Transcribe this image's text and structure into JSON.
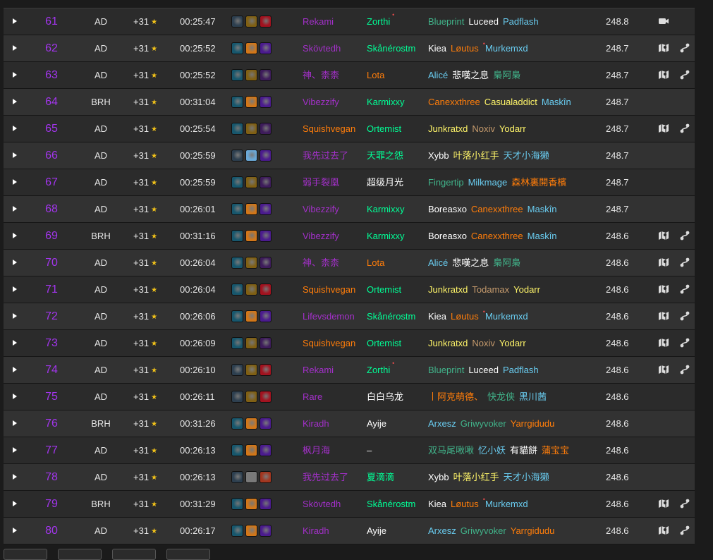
{
  "rows": [
    {
      "rank": "61",
      "dungeon": "AD",
      "level": "+31",
      "time": "00:25:47",
      "affixes": [
        "#2d3f4f",
        "#806014",
        "#a3121f"
      ],
      "tank": {
        "name": "Rekami",
        "color": "#a330c9"
      },
      "healer": {
        "name": "Zorthi",
        "color": "#00ff96",
        "mark": "•"
      },
      "dps": [
        {
          "name": "Blueprint",
          "color": "#41b38a"
        },
        {
          "name": "Luceed",
          "color": "#ffffff"
        },
        {
          "name": "Padflash",
          "color": "#69ccf0"
        }
      ],
      "score": "248.8",
      "icon1": "video-icon",
      "icon2": ""
    },
    {
      "rank": "62",
      "dungeon": "AD",
      "level": "+31",
      "time": "00:25:52",
      "affixes": [
        "#17576d",
        "#d27719",
        "#4b1b8e"
      ],
      "tank": {
        "name": "Skövtedh",
        "color": "#a330c9"
      },
      "healer": {
        "name": "Skånérostm",
        "color": "#00ff96"
      },
      "dps": [
        {
          "name": "Kiea",
          "color": "#ffffff"
        },
        {
          "name": "Løutus",
          "color": "#ff7d0a",
          "mark": "•"
        },
        {
          "name": "Murkemxd",
          "color": "#69ccf0"
        }
      ],
      "score": "248.7",
      "icon1": "map-icon",
      "icon2": "route-icon"
    },
    {
      "rank": "63",
      "dungeon": "AD",
      "level": "+31",
      "time": "00:25:52",
      "affixes": [
        "#17576d",
        "#806014",
        "#3e1c5b"
      ],
      "tank": {
        "name": "神、柰柰",
        "color": "#a330c9"
      },
      "healer": {
        "name": "Lota",
        "color": "#ff7d0a"
      },
      "dps": [
        {
          "name": "Alicé",
          "color": "#69ccf0"
        },
        {
          "name": "悲嘆之息",
          "color": "#ffffff"
        },
        {
          "name": "梟阿梟",
          "color": "#41b38a"
        }
      ],
      "score": "248.7",
      "icon1": "map-icon",
      "icon2": "route-icon"
    },
    {
      "rank": "64",
      "dungeon": "BRH",
      "level": "+31",
      "time": "00:31:04",
      "affixes": [
        "#17576d",
        "#d27719",
        "#4b1b8e"
      ],
      "tank": {
        "name": "Vibezzify",
        "color": "#a330c9"
      },
      "healer": {
        "name": "Karmixxy",
        "color": "#00ff96"
      },
      "dps": [
        {
          "name": "Canexxthree",
          "color": "#ff7d0a"
        },
        {
          "name": "Casualaddict",
          "color": "#fff569"
        },
        {
          "name": "Maskîn",
          "color": "#69ccf0"
        }
      ],
      "score": "248.7",
      "icon1": "",
      "icon2": ""
    },
    {
      "rank": "65",
      "dungeon": "AD",
      "level": "+31",
      "time": "00:25:54",
      "affixes": [
        "#17576d",
        "#806014",
        "#3e1c5b"
      ],
      "tank": {
        "name": "Squishvegan",
        "color": "#ff7d0a"
      },
      "healer": {
        "name": "Ortemist",
        "color": "#00ff96"
      },
      "dps": [
        {
          "name": "Junkratxd",
          "color": "#fff569"
        },
        {
          "name": "Noxiv",
          "color": "#c69b6d"
        },
        {
          "name": "Yodarr",
          "color": "#fff569"
        }
      ],
      "score": "248.7",
      "icon1": "map-icon",
      "icon2": "route-icon"
    },
    {
      "rank": "66",
      "dungeon": "AD",
      "level": "+31",
      "time": "00:25:59",
      "affixes": [
        "#2d3f4f",
        "#6aa9d8",
        "#4b1b8e"
      ],
      "tank": {
        "name": "我先过去了",
        "color": "#a330c9"
      },
      "healer": {
        "name": "天罪之怨",
        "color": "#00ff96"
      },
      "dps": [
        {
          "name": "Xybb",
          "color": "#ffffff"
        },
        {
          "name": "叶落小红手",
          "color": "#fff569"
        },
        {
          "name": "天才小海獭",
          "color": "#69ccf0"
        }
      ],
      "score": "248.7",
      "icon1": "",
      "icon2": ""
    },
    {
      "rank": "67",
      "dungeon": "AD",
      "level": "+31",
      "time": "00:25:59",
      "affixes": [
        "#17576d",
        "#806014",
        "#3e1c5b"
      ],
      "tank": {
        "name": "弱手裂凰",
        "color": "#a330c9"
      },
      "healer": {
        "name": "超级月光",
        "color": "#ffffff"
      },
      "dps": [
        {
          "name": "Fingertip",
          "color": "#41b38a"
        },
        {
          "name": "Milkmage",
          "color": "#69ccf0"
        },
        {
          "name": "森林裏開香檳",
          "color": "#ff7d0a"
        }
      ],
      "score": "248.7",
      "icon1": "",
      "icon2": ""
    },
    {
      "rank": "68",
      "dungeon": "AD",
      "level": "+31",
      "time": "00:26:01",
      "affixes": [
        "#17576d",
        "#d27719",
        "#4b1b8e"
      ],
      "tank": {
        "name": "Vibezzify",
        "color": "#a330c9"
      },
      "healer": {
        "name": "Karmixxy",
        "color": "#00ff96"
      },
      "dps": [
        {
          "name": "Boreasxo",
          "color": "#ffffff"
        },
        {
          "name": "Canexxthree",
          "color": "#ff7d0a"
        },
        {
          "name": "Maskîn",
          "color": "#69ccf0"
        }
      ],
      "score": "248.7",
      "icon1": "",
      "icon2": ""
    },
    {
      "rank": "69",
      "dungeon": "BRH",
      "level": "+31",
      "time": "00:31:16",
      "affixes": [
        "#17576d",
        "#d27719",
        "#4b1b8e"
      ],
      "tank": {
        "name": "Vibezzify",
        "color": "#a330c9"
      },
      "healer": {
        "name": "Karmixxy",
        "color": "#00ff96"
      },
      "dps": [
        {
          "name": "Boreasxo",
          "color": "#ffffff"
        },
        {
          "name": "Canexxthree",
          "color": "#ff7d0a"
        },
        {
          "name": "Maskîn",
          "color": "#69ccf0"
        }
      ],
      "score": "248.6",
      "icon1": "map-icon",
      "icon2": "route-icon"
    },
    {
      "rank": "70",
      "dungeon": "AD",
      "level": "+31",
      "time": "00:26:04",
      "affixes": [
        "#17576d",
        "#806014",
        "#3e1c5b"
      ],
      "tank": {
        "name": "神、柰柰",
        "color": "#a330c9"
      },
      "healer": {
        "name": "Lota",
        "color": "#ff7d0a"
      },
      "dps": [
        {
          "name": "Alicé",
          "color": "#69ccf0"
        },
        {
          "name": "悲嘆之息",
          "color": "#ffffff"
        },
        {
          "name": "梟阿梟",
          "color": "#41b38a"
        }
      ],
      "score": "248.6",
      "icon1": "map-icon",
      "icon2": "route-icon"
    },
    {
      "rank": "71",
      "dungeon": "AD",
      "level": "+31",
      "time": "00:26:04",
      "affixes": [
        "#17576d",
        "#806014",
        "#a3121f"
      ],
      "tank": {
        "name": "Squishvegan",
        "color": "#ff7d0a"
      },
      "healer": {
        "name": "Ortemist",
        "color": "#00ff96"
      },
      "dps": [
        {
          "name": "Junkratxd",
          "color": "#fff569"
        },
        {
          "name": "Todamax",
          "color": "#c69b6d"
        },
        {
          "name": "Yodarr",
          "color": "#fff569"
        }
      ],
      "score": "248.6",
      "icon1": "map-icon",
      "icon2": "route-icon"
    },
    {
      "rank": "72",
      "dungeon": "AD",
      "level": "+31",
      "time": "00:26:06",
      "affixes": [
        "#17576d",
        "#d27719",
        "#4b1b8e"
      ],
      "tank": {
        "name": "Lifevsdemon",
        "color": "#a330c9"
      },
      "healer": {
        "name": "Skånérostm",
        "color": "#00ff96"
      },
      "dps": [
        {
          "name": "Kiea",
          "color": "#ffffff"
        },
        {
          "name": "Løutus",
          "color": "#ff7d0a",
          "mark": "•"
        },
        {
          "name": "Murkemxd",
          "color": "#69ccf0"
        }
      ],
      "score": "248.6",
      "icon1": "map-icon",
      "icon2": "route-icon"
    },
    {
      "rank": "73",
      "dungeon": "AD",
      "level": "+31",
      "time": "00:26:09",
      "affixes": [
        "#17576d",
        "#806014",
        "#3e1c5b"
      ],
      "tank": {
        "name": "Squishvegan",
        "color": "#ff7d0a"
      },
      "healer": {
        "name": "Ortemist",
        "color": "#00ff96"
      },
      "dps": [
        {
          "name": "Junkratxd",
          "color": "#fff569"
        },
        {
          "name": "Noxiv",
          "color": "#c69b6d"
        },
        {
          "name": "Yodarr",
          "color": "#fff569"
        }
      ],
      "score": "248.6",
      "icon1": "map-icon",
      "icon2": "route-icon"
    },
    {
      "rank": "74",
      "dungeon": "AD",
      "level": "+31",
      "time": "00:26:10",
      "affixes": [
        "#2d3f4f",
        "#806014",
        "#a3121f"
      ],
      "tank": {
        "name": "Rekami",
        "color": "#a330c9"
      },
      "healer": {
        "name": "Zorthi",
        "color": "#00ff96",
        "mark": "•"
      },
      "dps": [
        {
          "name": "Blueprint",
          "color": "#41b38a"
        },
        {
          "name": "Luceed",
          "color": "#ffffff"
        },
        {
          "name": "Padflash",
          "color": "#69ccf0"
        }
      ],
      "score": "248.6",
      "icon1": "map-icon",
      "icon2": "route-icon"
    },
    {
      "rank": "75",
      "dungeon": "AD",
      "level": "+31",
      "time": "00:26:11",
      "affixes": [
        "#2d3f4f",
        "#806014",
        "#a3121f"
      ],
      "tank": {
        "name": "Rare",
        "color": "#a330c9"
      },
      "healer": {
        "name": "白白乌龙",
        "color": "#ffffff"
      },
      "dps": [
        {
          "name": "丨阿克萌德、",
          "color": "#ff7d0a"
        },
        {
          "name": "快龙侠",
          "color": "#41b38a"
        },
        {
          "name": "黑川茜",
          "color": "#69ccf0"
        }
      ],
      "score": "248.6",
      "icon1": "",
      "icon2": ""
    },
    {
      "rank": "76",
      "dungeon": "BRH",
      "level": "+31",
      "time": "00:31:26",
      "affixes": [
        "#17576d",
        "#d27719",
        "#4b1b8e"
      ],
      "tank": {
        "name": "Kiradh",
        "color": "#a330c9"
      },
      "healer": {
        "name": "Ayije",
        "color": "#ffffff"
      },
      "dps": [
        {
          "name": "Arxesz",
          "color": "#69ccf0"
        },
        {
          "name": "Griwyvoker",
          "color": "#41b38a"
        },
        {
          "name": "Yarrgidudu",
          "color": "#ff7d0a"
        }
      ],
      "score": "248.6",
      "icon1": "",
      "icon2": ""
    },
    {
      "rank": "77",
      "dungeon": "AD",
      "level": "+31",
      "time": "00:26:13",
      "affixes": [
        "#17576d",
        "#d27719",
        "#4b1b8e"
      ],
      "tank": {
        "name": "枫月海",
        "color": "#a330c9"
      },
      "healer": {
        "name": "–",
        "color": "#ffffff"
      },
      "dps": [
        {
          "name": "双马尾啾啾",
          "color": "#41b38a"
        },
        {
          "name": "忆小妖",
          "color": "#69ccf0"
        },
        {
          "name": "有貓餅",
          "color": "#ffffff"
        },
        {
          "name": "蒲宝宝",
          "color": "#ff7d0a"
        }
      ],
      "score": "248.6",
      "icon1": "",
      "icon2": ""
    },
    {
      "rank": "78",
      "dungeon": "AD",
      "level": "+31",
      "time": "00:26:13",
      "affixes": [
        "#2d3f4f",
        "#7a7a7a",
        "#a3361f"
      ],
      "tank": {
        "name": "我先过去了",
        "color": "#a330c9"
      },
      "healer": {
        "name": "夏滴滴",
        "color": "#00ff96"
      },
      "dps": [
        {
          "name": "Xybb",
          "color": "#ffffff"
        },
        {
          "name": "叶落小红手",
          "color": "#fff569"
        },
        {
          "name": "天才小海獭",
          "color": "#69ccf0"
        }
      ],
      "score": "248.6",
      "icon1": "",
      "icon2": ""
    },
    {
      "rank": "79",
      "dungeon": "BRH",
      "level": "+31",
      "time": "00:31:29",
      "affixes": [
        "#17576d",
        "#d27719",
        "#4b1b8e"
      ],
      "tank": {
        "name": "Skövtedh",
        "color": "#a330c9"
      },
      "healer": {
        "name": "Skånérostm",
        "color": "#00ff96"
      },
      "dps": [
        {
          "name": "Kiea",
          "color": "#ffffff"
        },
        {
          "name": "Løutus",
          "color": "#ff7d0a",
          "mark": "•"
        },
        {
          "name": "Murkemxd",
          "color": "#69ccf0"
        }
      ],
      "score": "248.6",
      "icon1": "map-icon",
      "icon2": "route-icon"
    },
    {
      "rank": "80",
      "dungeon": "AD",
      "level": "+31",
      "time": "00:26:17",
      "affixes": [
        "#17576d",
        "#d27719",
        "#4b1b8e"
      ],
      "tank": {
        "name": "Kiradh",
        "color": "#a330c9"
      },
      "healer": {
        "name": "Ayije",
        "color": "#ffffff"
      },
      "dps": [
        {
          "name": "Arxesz",
          "color": "#69ccf0"
        },
        {
          "name": "Griwyvoker",
          "color": "#41b38a"
        },
        {
          "name": "Yarrgidudu",
          "color": "#ff7d0a"
        }
      ],
      "score": "248.6",
      "icon1": "map-icon",
      "icon2": "route-icon"
    }
  ],
  "star": "★"
}
